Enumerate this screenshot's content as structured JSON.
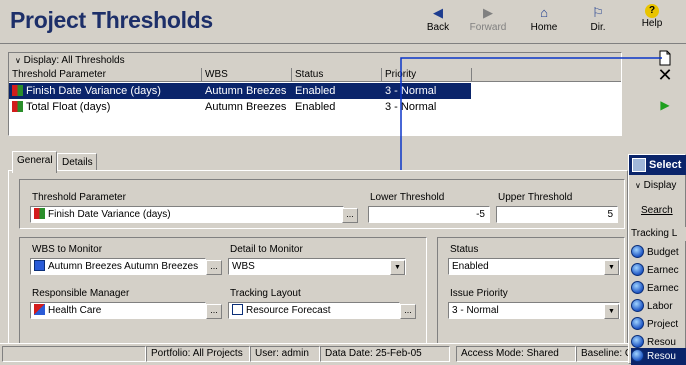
{
  "title": "Project Thresholds",
  "toolbar": {
    "back": "Back",
    "forward": "Forward",
    "home": "Home",
    "dir": "Dir.",
    "help": "Help"
  },
  "display_label": "Display: All Thresholds",
  "grid": {
    "headers": [
      "Threshold Parameter",
      "WBS",
      "Status",
      "Priority"
    ],
    "rows": [
      {
        "param": "Finish Date Variance (days)",
        "wbs": "Autumn Breezes",
        "status": "Enabled",
        "priority": "3 - Normal"
      },
      {
        "param": "Total Float (days)",
        "wbs": "Autumn Breezes",
        "status": "Enabled",
        "priority": "3 - Normal"
      }
    ]
  },
  "tabs": [
    "General",
    "Details"
  ],
  "form": {
    "threshold_parameter_label": "Threshold Parameter",
    "threshold_parameter_value": "Finish Date Variance (days)",
    "lower_threshold_label": "Lower Threshold",
    "lower_threshold_value": "-5",
    "upper_threshold_label": "Upper Threshold",
    "upper_threshold_value": "5",
    "wbs_label": "WBS to Monitor",
    "wbs_value": "Autumn Breezes  Autumn Breezes",
    "detail_label": "Detail to Monitor",
    "detail_value": "WBS",
    "responsible_label": "Responsible Manager",
    "responsible_value": "Health Care",
    "tracking_label": "Tracking Layout",
    "tracking_value": "Resource Forecast",
    "status_label": "Status",
    "status_value": "Enabled",
    "priority_label": "Issue Priority",
    "priority_value": "3 - Normal",
    "ellipsis": "..."
  },
  "statusbar": {
    "portfolio": "Portfolio: All Projects",
    "user": "User: admin",
    "data_date": "Data Date: 25-Feb-05",
    "access": "Access Mode: Shared",
    "baseline": "Baseline: C"
  },
  "popup": {
    "title": "Select",
    "display": "Display",
    "search": "Search",
    "section": "Tracking L",
    "items": [
      "Budget",
      "Earnec",
      "Earnec",
      "Labor",
      "Project",
      "Resou",
      "Resou"
    ]
  },
  "colors": {
    "selection": "#0a246a",
    "title_text": "#1d2f69",
    "background": "#d4d0c8"
  }
}
